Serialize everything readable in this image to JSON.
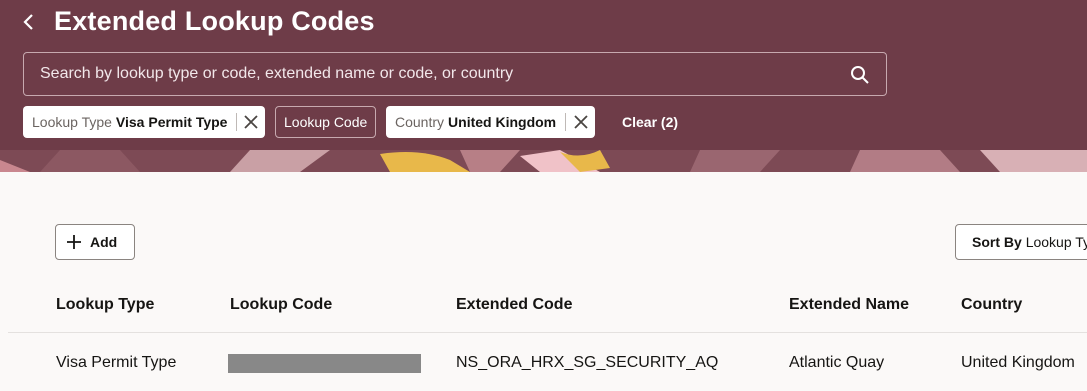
{
  "header": {
    "title": "Extended Lookup Codes",
    "search_placeholder": "Search by lookup type or code, extended name or code, or country"
  },
  "filters": [
    {
      "label": "Lookup Type",
      "value": "Visa Permit Type"
    },
    {
      "label": "Lookup Code",
      "value": ""
    },
    {
      "label": "Country",
      "value": "United Kingdom"
    }
  ],
  "clear_label": "Clear (2)",
  "toolbar": {
    "add_label": "Add",
    "sort_prefix": "Sort By",
    "sort_value": "Lookup Type"
  },
  "table": {
    "columns": [
      "Lookup Type",
      "Lookup Code",
      "Extended Code",
      "Extended Name",
      "Country"
    ],
    "rows": [
      {
        "lookup_type": "Visa Permit Type",
        "lookup_code": "",
        "extended_code": "NS_ORA_HRX_SG_SECURITY_AQ",
        "extended_name": "Atlantic Quay",
        "country": "United Kingdom"
      }
    ]
  },
  "colors": {
    "header_bg": "#6e3c48",
    "page_bg": "#fbf9f8"
  }
}
